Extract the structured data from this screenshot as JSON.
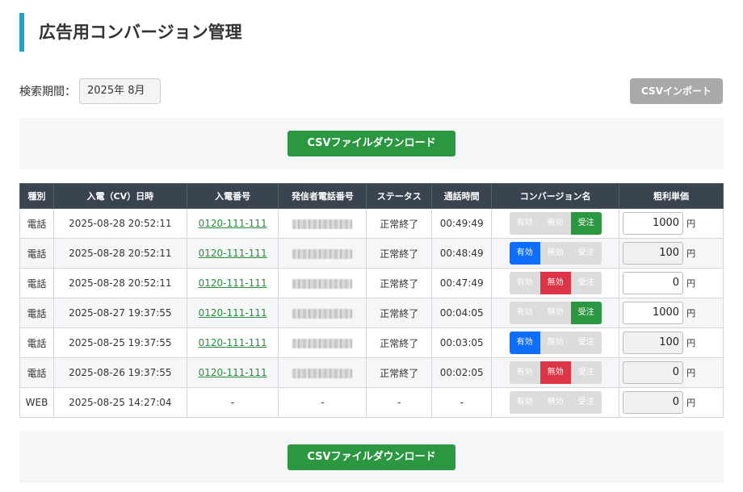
{
  "page": {
    "title": "広告用コンバージョン管理"
  },
  "filter": {
    "period_label": "検索期間：",
    "period_value": "2025年 8月"
  },
  "actions": {
    "csv_import": "CSVインポート",
    "csv_download": "CSVファイルダウンロード"
  },
  "table": {
    "headers": [
      "種別",
      "入電（CV）日時",
      "入電番号",
      "発信者電話番号",
      "ステータス",
      "通話時間",
      "コンバージョン名",
      "粗利単価"
    ],
    "cv_options": [
      "有効",
      "無効",
      "受注"
    ],
    "currency": "円",
    "rows": [
      {
        "type": "電話",
        "datetime": "2025-08-28 20:52:11",
        "number": "0120-111-111",
        "status": "正常終了",
        "duration": "00:49:49",
        "selected": "受注",
        "profit": "1000"
      },
      {
        "type": "電話",
        "datetime": "2025-08-28 20:52:11",
        "number": "0120-111-111",
        "status": "正常終了",
        "duration": "00:48:49",
        "selected": "有効",
        "profit": "100"
      },
      {
        "type": "電話",
        "datetime": "2025-08-28 20:52:11",
        "number": "0120-111-111",
        "status": "正常終了",
        "duration": "00:47:49",
        "selected": "無効",
        "profit": "0"
      },
      {
        "type": "電話",
        "datetime": "2025-08-27 19:37:55",
        "number": "0120-111-111",
        "status": "正常終了",
        "duration": "00:04:05",
        "selected": "受注",
        "profit": "1000"
      },
      {
        "type": "電話",
        "datetime": "2025-08-25 19:37:55",
        "number": "0120-111-111",
        "status": "正常終了",
        "duration": "00:03:05",
        "selected": "有効",
        "profit": "100"
      },
      {
        "type": "電話",
        "datetime": "2025-08-26 19:37:55",
        "number": "0120-111-111",
        "status": "正常終了",
        "duration": "00:02:05",
        "selected": "無効",
        "profit": "0"
      },
      {
        "type": "WEB",
        "datetime": "2025-08-25 14:27:04",
        "number": "-",
        "caller": "-",
        "status": "-",
        "duration": "-",
        "selected": "",
        "profit": "0"
      }
    ]
  },
  "colors": {
    "accent": "#2aa0c8",
    "download": "#2b9740",
    "header_bg": "#3a4350",
    "valid": "#0d6efd",
    "invalid": "#dc3545",
    "order": "#2b9740"
  }
}
